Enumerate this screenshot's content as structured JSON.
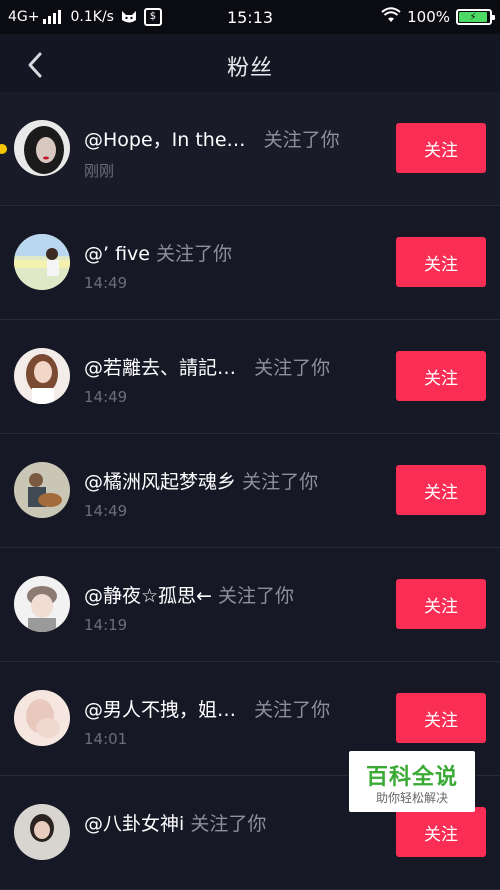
{
  "status_bar": {
    "network": "4G+",
    "speed": "0.1K/s",
    "time": "15:13",
    "battery": "100%",
    "battery_color": "#4cd964"
  },
  "header": {
    "title": "粉丝",
    "back_icon": "chevron-left-icon"
  },
  "colors": {
    "accent": "#fa2d55",
    "unread_dot": "#f6c500",
    "background": "#121320"
  },
  "followers": [
    {
      "name": "@Hope，In the…",
      "action": "关注了你",
      "time": "刚刚",
      "button": "关注",
      "unread": true
    },
    {
      "name": "@’  five",
      "action": "关注了你",
      "time": "14:49",
      "button": "关注",
      "unread": false
    },
    {
      "name": "@若離去、請記…",
      "action": "关注了你",
      "time": "14:49",
      "button": "关注",
      "unread": false
    },
    {
      "name": "@橘洲风起梦魂乡",
      "action": "关注了你",
      "time": "14:49",
      "button": "关注",
      "unread": false
    },
    {
      "name": "@静夜☆孤思←",
      "action": "关注了你",
      "time": "14:19",
      "button": "关注",
      "unread": false
    },
    {
      "name": "@男人不拽，姐…",
      "action": "关注了你",
      "time": "14:01",
      "button": "关注",
      "unread": false
    },
    {
      "name": "@八卦女神i",
      "action": "关注了你",
      "time": "",
      "button": "关注",
      "unread": false
    }
  ],
  "watermark": {
    "main": "百科全说",
    "sub": "助你轻松解决"
  }
}
